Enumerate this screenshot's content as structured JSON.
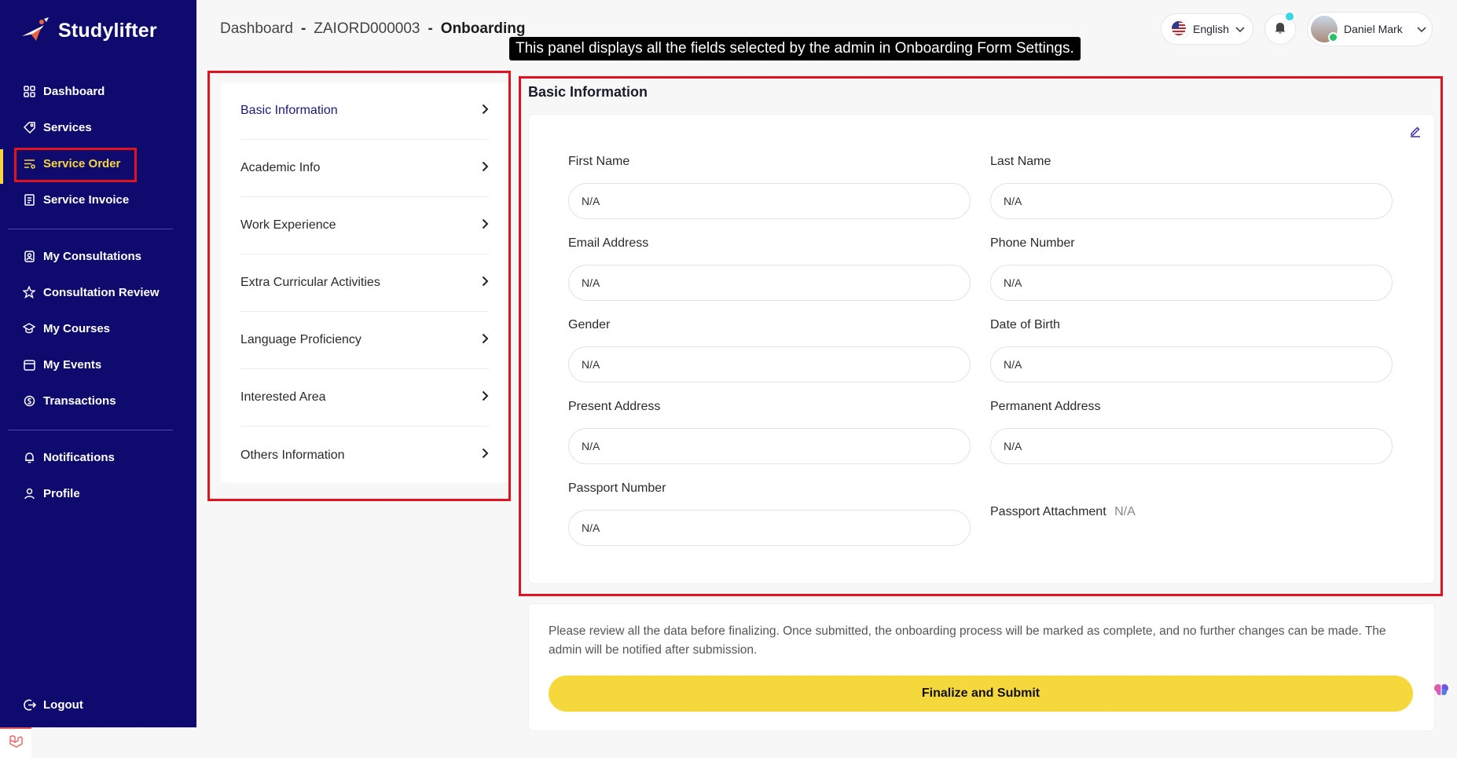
{
  "brand": {
    "name": "Studylifter"
  },
  "sidebar": {
    "items": [
      {
        "label": "Dashboard",
        "icon": "grid-icon"
      },
      {
        "label": "Services",
        "icon": "tag-icon"
      },
      {
        "label": "Service Order",
        "icon": "list-filter-icon",
        "active": true
      },
      {
        "label": "Service Invoice",
        "icon": "invoice-icon"
      },
      {
        "label": "My Consultations",
        "icon": "consultation-icon"
      },
      {
        "label": "Consultation Review",
        "icon": "star-icon"
      },
      {
        "label": "My Courses",
        "icon": "course-icon"
      },
      {
        "label": "My Events",
        "icon": "calendar-icon"
      },
      {
        "label": "Transactions",
        "icon": "money-icon"
      },
      {
        "label": "Notifications",
        "icon": "bell-icon"
      },
      {
        "label": "Profile",
        "icon": "user-icon"
      }
    ],
    "logout": "Logout"
  },
  "header": {
    "breadcrumb": [
      "Dashboard",
      "ZAIORD000003",
      "Onboarding"
    ],
    "separator": "-",
    "language": "English",
    "user_name": "Daniel Mark"
  },
  "tooltip": "This panel displays all the fields selected by the admin in Onboarding Form Settings.",
  "sections": [
    {
      "label": "Basic Information",
      "active": true
    },
    {
      "label": "Academic Info"
    },
    {
      "label": "Work Experience"
    },
    {
      "label": "Extra Curricular Activities"
    },
    {
      "label": "Language Proficiency"
    },
    {
      "label": "Interested Area"
    },
    {
      "label": "Others Information"
    }
  ],
  "panel": {
    "title": "Basic Information",
    "fields": [
      {
        "label": "First Name",
        "value": "N/A"
      },
      {
        "label": "Last Name",
        "value": "N/A"
      },
      {
        "label": "Email Address",
        "value": "N/A"
      },
      {
        "label": "Phone Number",
        "value": "N/A"
      },
      {
        "label": "Gender",
        "value": "N/A"
      },
      {
        "label": "Date of Birth",
        "value": "N/A"
      },
      {
        "label": "Present Address",
        "value": "N/A"
      },
      {
        "label": "Permanent Address",
        "value": "N/A"
      },
      {
        "label": "Passport Number",
        "value": "N/A"
      }
    ],
    "attachment": {
      "label": "Passport Attachment",
      "value": "N/A"
    }
  },
  "submit": {
    "note": "Please review all the data before finalizing. Once submitted, the onboarding process will be marked as complete, and no further changes can be made. The admin will be notified after submission.",
    "button": "Finalize and Submit"
  },
  "colors": {
    "sidebar": "#0e0a6e",
    "accent": "#f5d83b",
    "highlight": "#e1131e"
  }
}
